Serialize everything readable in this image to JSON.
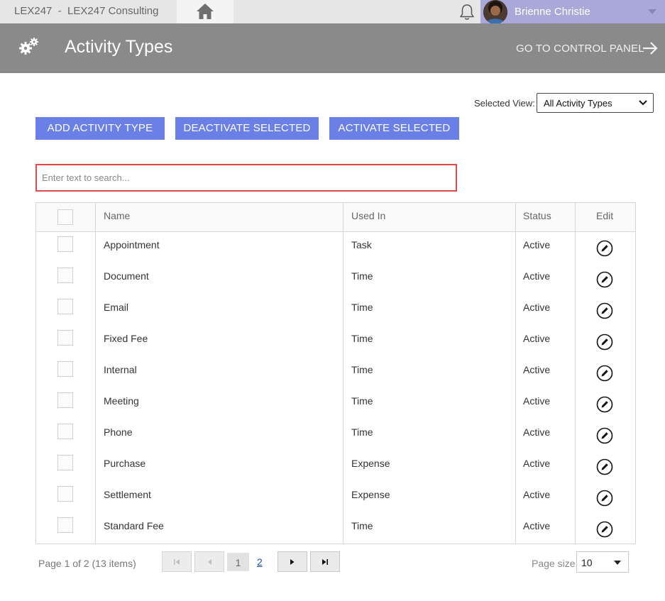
{
  "topbar": {
    "company": "LEX247  -  LEX247 Consulting",
    "user_name": "Brienne Christie"
  },
  "header": {
    "title": "Activity Types",
    "control_panel_link": "GO TO CONTROL PANEL"
  },
  "view": {
    "label": "Selected View:",
    "selected": "All Activity Types"
  },
  "actions": {
    "add": "ADD ACTIVITY TYPE",
    "deactivate": "DEACTIVATE SELECTED",
    "activate": "ACTIVATE SELECTED"
  },
  "search": {
    "placeholder": "Enter text to search..."
  },
  "grid": {
    "columns": [
      "Name",
      "Used In",
      "Status",
      "Edit"
    ],
    "rows": [
      {
        "name": "Appointment",
        "used_in": "Task",
        "status": "Active"
      },
      {
        "name": "Document",
        "used_in": "Time",
        "status": "Active"
      },
      {
        "name": "Email",
        "used_in": "Time",
        "status": "Active"
      },
      {
        "name": "Fixed Fee",
        "used_in": "Time",
        "status": "Active"
      },
      {
        "name": "Internal",
        "used_in": "Time",
        "status": "Active"
      },
      {
        "name": "Meeting",
        "used_in": "Time",
        "status": "Active"
      },
      {
        "name": "Phone",
        "used_in": "Time",
        "status": "Active"
      },
      {
        "name": "Purchase",
        "used_in": "Expense",
        "status": "Active"
      },
      {
        "name": "Settlement",
        "used_in": "Expense",
        "status": "Active"
      },
      {
        "name": "Standard Fee",
        "used_in": "Time",
        "status": "Active"
      }
    ]
  },
  "pager": {
    "info": "Page 1 of 2 (13 items)",
    "current_page": "1",
    "next_page": "2",
    "page_size_label": "Page size:",
    "page_size": "10"
  },
  "colors": {
    "button": "#6a80e6",
    "header": "#8a8a8a",
    "user_area": "#a9a8d8",
    "search_border": "#e24a4a"
  }
}
